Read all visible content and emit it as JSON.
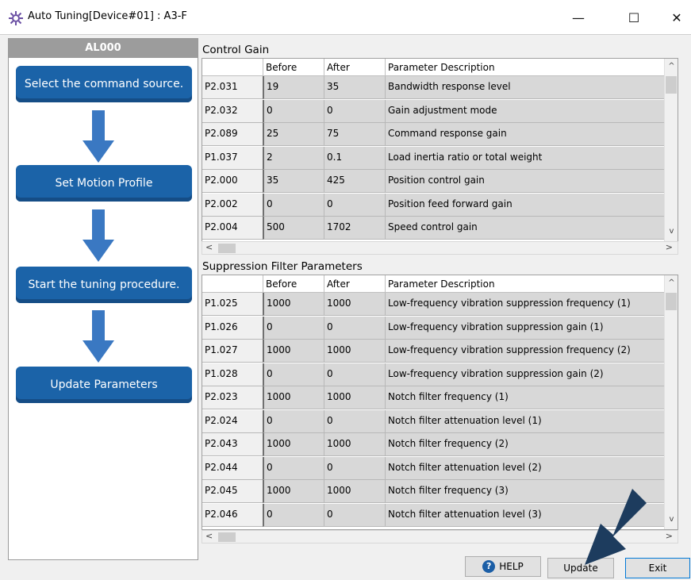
{
  "window": {
    "title": "Auto Tuning[Device#01] : A3-F",
    "controls": {
      "minimize": "—",
      "maximize": "☐",
      "close": "✕"
    }
  },
  "sidebar": {
    "alarm": "AL000",
    "steps": [
      {
        "label": "Select the command source."
      },
      {
        "label": "Set Motion Profile"
      },
      {
        "label": "Start the tuning procedure."
      },
      {
        "label": "Update Parameters"
      }
    ]
  },
  "control_gain": {
    "title": "Control Gain",
    "headers": [
      "",
      "Before",
      "After",
      "Parameter Description"
    ],
    "rows": [
      [
        "P2.031",
        "19",
        "35",
        "Bandwidth response level"
      ],
      [
        "P2.032",
        "0",
        "0",
        "Gain adjustment mode"
      ],
      [
        "P2.089",
        "25",
        "75",
        "Command response gain"
      ],
      [
        "P1.037",
        "2",
        "0.1",
        "Load inertia ratio or total weight"
      ],
      [
        "P2.000",
        "35",
        "425",
        "Position control gain"
      ],
      [
        "P2.002",
        "0",
        "0",
        "Position feed forward gain"
      ],
      [
        "P2.004",
        "500",
        "1702",
        "Speed control gain"
      ]
    ]
  },
  "suppression_filter": {
    "title": "Suppression Filter Parameters",
    "headers": [
      "",
      "Before",
      "After",
      "Parameter Description"
    ],
    "rows": [
      [
        "P1.025",
        "1000",
        "1000",
        "Low-frequency vibration suppression frequency (1)"
      ],
      [
        "P1.026",
        "0",
        "0",
        "Low-frequency vibration suppression gain (1)"
      ],
      [
        "P1.027",
        "1000",
        "1000",
        "Low-frequency vibration suppression frequency (2)"
      ],
      [
        "P1.028",
        "0",
        "0",
        "Low-frequency vibration suppression gain (2)"
      ],
      [
        "P2.023",
        "1000",
        "1000",
        "Notch filter frequency (1)"
      ],
      [
        "P2.024",
        "0",
        "0",
        "Notch filter attenuation level (1)"
      ],
      [
        "P2.043",
        "1000",
        "1000",
        "Notch filter frequency (2)"
      ],
      [
        "P2.044",
        "0",
        "0",
        "Notch filter attenuation level (2)"
      ],
      [
        "P2.045",
        "1000",
        "1000",
        "Notch filter frequency (3)"
      ],
      [
        "P2.046",
        "0",
        "0",
        "Notch filter attenuation level (3)"
      ]
    ]
  },
  "footer": {
    "help_label": "HELP",
    "update_label": "Update",
    "exit_label": "Exit"
  },
  "colors": {
    "step_button": "#1b63a8",
    "arrow": "#3a78c2",
    "alarm_bar": "#9c9c9c",
    "pointer_arrow": "#1d3c5e"
  },
  "icons": {
    "app": "gear-icon",
    "step_arrow": "arrow-down-icon",
    "help": "question-circle-icon",
    "pointer": "pointer-arrow-icon"
  }
}
